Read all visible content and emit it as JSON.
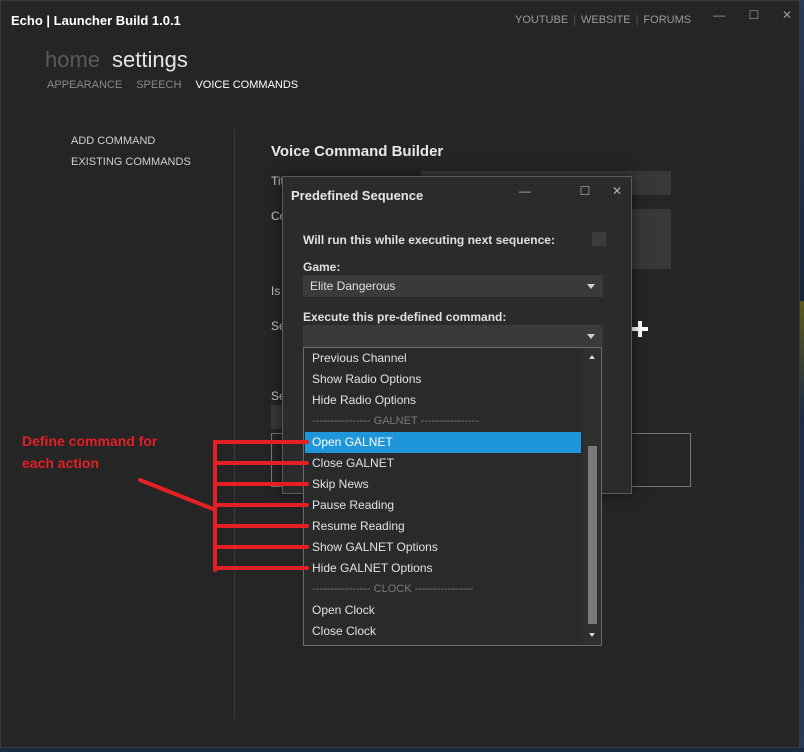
{
  "app": {
    "title": "Echo | Launcher Build 1.0.1",
    "links": [
      "YOUTUBE",
      "WEBSITE",
      "FORUMS"
    ],
    "window_controls": {
      "minimize": "—",
      "maximize": "☐",
      "close": "✕"
    }
  },
  "nav": {
    "home": "home",
    "settings": "settings",
    "tabs": [
      "APPEARANCE",
      "SPEECH",
      "VOICE COMMANDS"
    ],
    "active_tab": "VOICE COMMANDS"
  },
  "sidebar": {
    "items": [
      "ADD COMMAND",
      "EXISTING COMMANDS"
    ]
  },
  "builder": {
    "title": "Voice Command Builder",
    "partial_labels": [
      "Tit",
      "Co",
      "Is",
      "Se",
      "Se"
    ]
  },
  "dialog": {
    "title": "Predefined Sequence",
    "controls": {
      "minimize": "—",
      "maximize": "☐",
      "close": "✕"
    },
    "run_label": "Will run this while executing next sequence:",
    "game_label": "Game:",
    "game_value": "Elite Dangerous",
    "command_label": "Execute this pre-defined command:",
    "command_value": ""
  },
  "dropdown": {
    "options": [
      {
        "label": "Previous Channel",
        "kind": "item"
      },
      {
        "label": "Show Radio Options",
        "kind": "item"
      },
      {
        "label": "Hide Radio Options",
        "kind": "item"
      },
      {
        "label": "---------------- GALNET ----------------",
        "kind": "divider"
      },
      {
        "label": "Open GALNET",
        "kind": "selected"
      },
      {
        "label": "Close GALNET",
        "kind": "item"
      },
      {
        "label": "Skip News",
        "kind": "item"
      },
      {
        "label": "Pause Reading",
        "kind": "item"
      },
      {
        "label": "Resume Reading",
        "kind": "item"
      },
      {
        "label": "Show GALNET Options",
        "kind": "item"
      },
      {
        "label": "Hide GALNET Options",
        "kind": "item"
      },
      {
        "label": "---------------- CLOCK ----------------",
        "kind": "divider"
      },
      {
        "label": "Open Clock",
        "kind": "item"
      },
      {
        "label": "Close Clock",
        "kind": "item"
      }
    ]
  },
  "annotation": {
    "text_line1": "Define command for",
    "text_line2": "each action",
    "color": "#e41f26"
  },
  "colors": {
    "accent": "#1f96d9",
    "background": "#252525"
  }
}
